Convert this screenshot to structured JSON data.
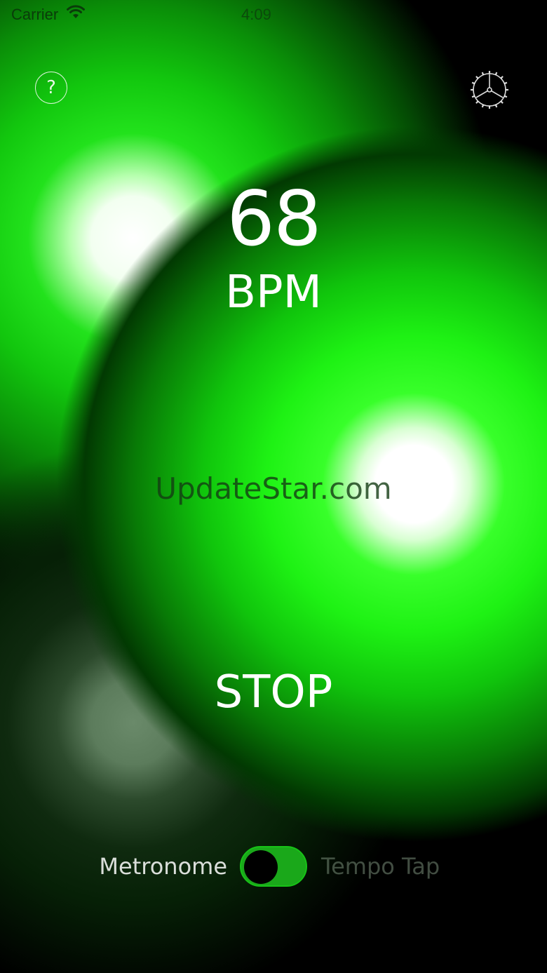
{
  "status_bar": {
    "carrier": "Carrier",
    "time": "4:09",
    "wifi_icon": "wifi-icon"
  },
  "toolbar": {
    "help_icon": "help-icon",
    "help_glyph": "?",
    "settings_icon": "gear-icon"
  },
  "tempo": {
    "value": "68",
    "unit": "BPM"
  },
  "watermark": "UpdateStar.com",
  "playback": {
    "stop_label": "STOP"
  },
  "mode_switch": {
    "left_label": "Metronome",
    "right_label": "Tempo Tap",
    "active": "Metronome"
  },
  "colors": {
    "glow_green": "#1ef214",
    "toggle_green": "#1aa81a",
    "background": "#000000"
  }
}
